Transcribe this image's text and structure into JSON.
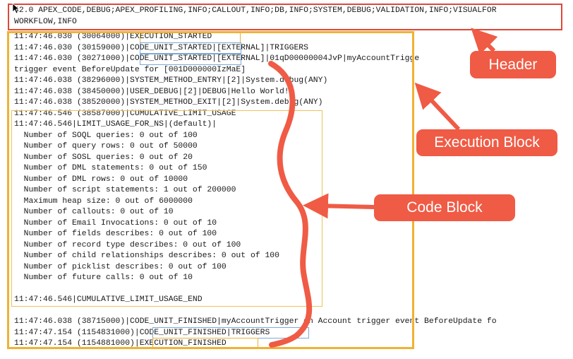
{
  "header": {
    "line1": "42.0 APEX_CODE,DEBUG;APEX_PROFILING,INFO;CALLOUT,INFO;DB,INFO;SYSTEM,DEBUG;VALIDATION,INFO;VISUALFOR",
    "line2": "WORKFLOW,INFO"
  },
  "log_lines": [
    "11:47:46.030 (30064000)|EXECUTION_STARTED",
    "11:47:46.030 (30159000)|CODE_UNIT_STARTED|[EXTERNAL]|TRIGGERS",
    "11:47:46.030 (30271000)|CODE_UNIT_STARTED|[EXTERNAL]|01qD00000004JvP|myAccountTrigge",
    "trigger event BeforeUpdate for [001D000000IzMaE]",
    "11:47:46.038 (38296000)|SYSTEM_METHOD_ENTRY|[2]|System.debug(ANY)",
    "11:47:46.038 (38450000)|USER_DEBUG|[2]|DEBUG|Hello World!",
    "11:47:46.038 (38520000)|SYSTEM_METHOD_EXIT|[2]|System.debug(ANY)",
    "11:47:46.546 (38587000)|CUMULATIVE_LIMIT_USAGE",
    "11:47:46.546|LIMIT_USAGE_FOR_NS|(default)|",
    "  Number of SOQL queries: 0 out of 100",
    "  Number of query rows: 0 out of 50000",
    "  Number of SOSL queries: 0 out of 20",
    "  Number of DML statements: 0 out of 150",
    "  Number of DML rows: 0 out of 10000",
    "  Number of script statements: 1 out of 200000",
    "  Maximum heap size: 0 out of 6000000",
    "  Number of callouts: 0 out of 10",
    "  Number of Email Invocations: 0 out of 10",
    "  Number of fields describes: 0 out of 100",
    "  Number of record type describes: 0 out of 100",
    "  Number of child relationships describes: 0 out of 100",
    "  Number of picklist describes: 0 out of 100",
    "  Number of future calls: 0 out of 10",
    "",
    "11:47:46.546|CUMULATIVE_LIMIT_USAGE_END",
    "",
    "11:47:46.038 (38715000)|CODE_UNIT_FINISHED|myAccountTrigger on Account trigger event BeforeUpdate fo",
    "11:47:47.154 (1154831000)|CODE_UNIT_FINISHED|TRIGGERS",
    "11:47:47.154 (1154881000)|EXECUTION_FINISHED"
  ],
  "callouts": {
    "header": "Header",
    "execution_block": "Execution Block",
    "code_block": "Code Block"
  },
  "colors": {
    "callout_fill": "#ef5b45",
    "header_box": "#e0463a",
    "execution_box": "#efb232",
    "code_box": "#efc25a",
    "token_highlight": "#7ea9d6"
  }
}
